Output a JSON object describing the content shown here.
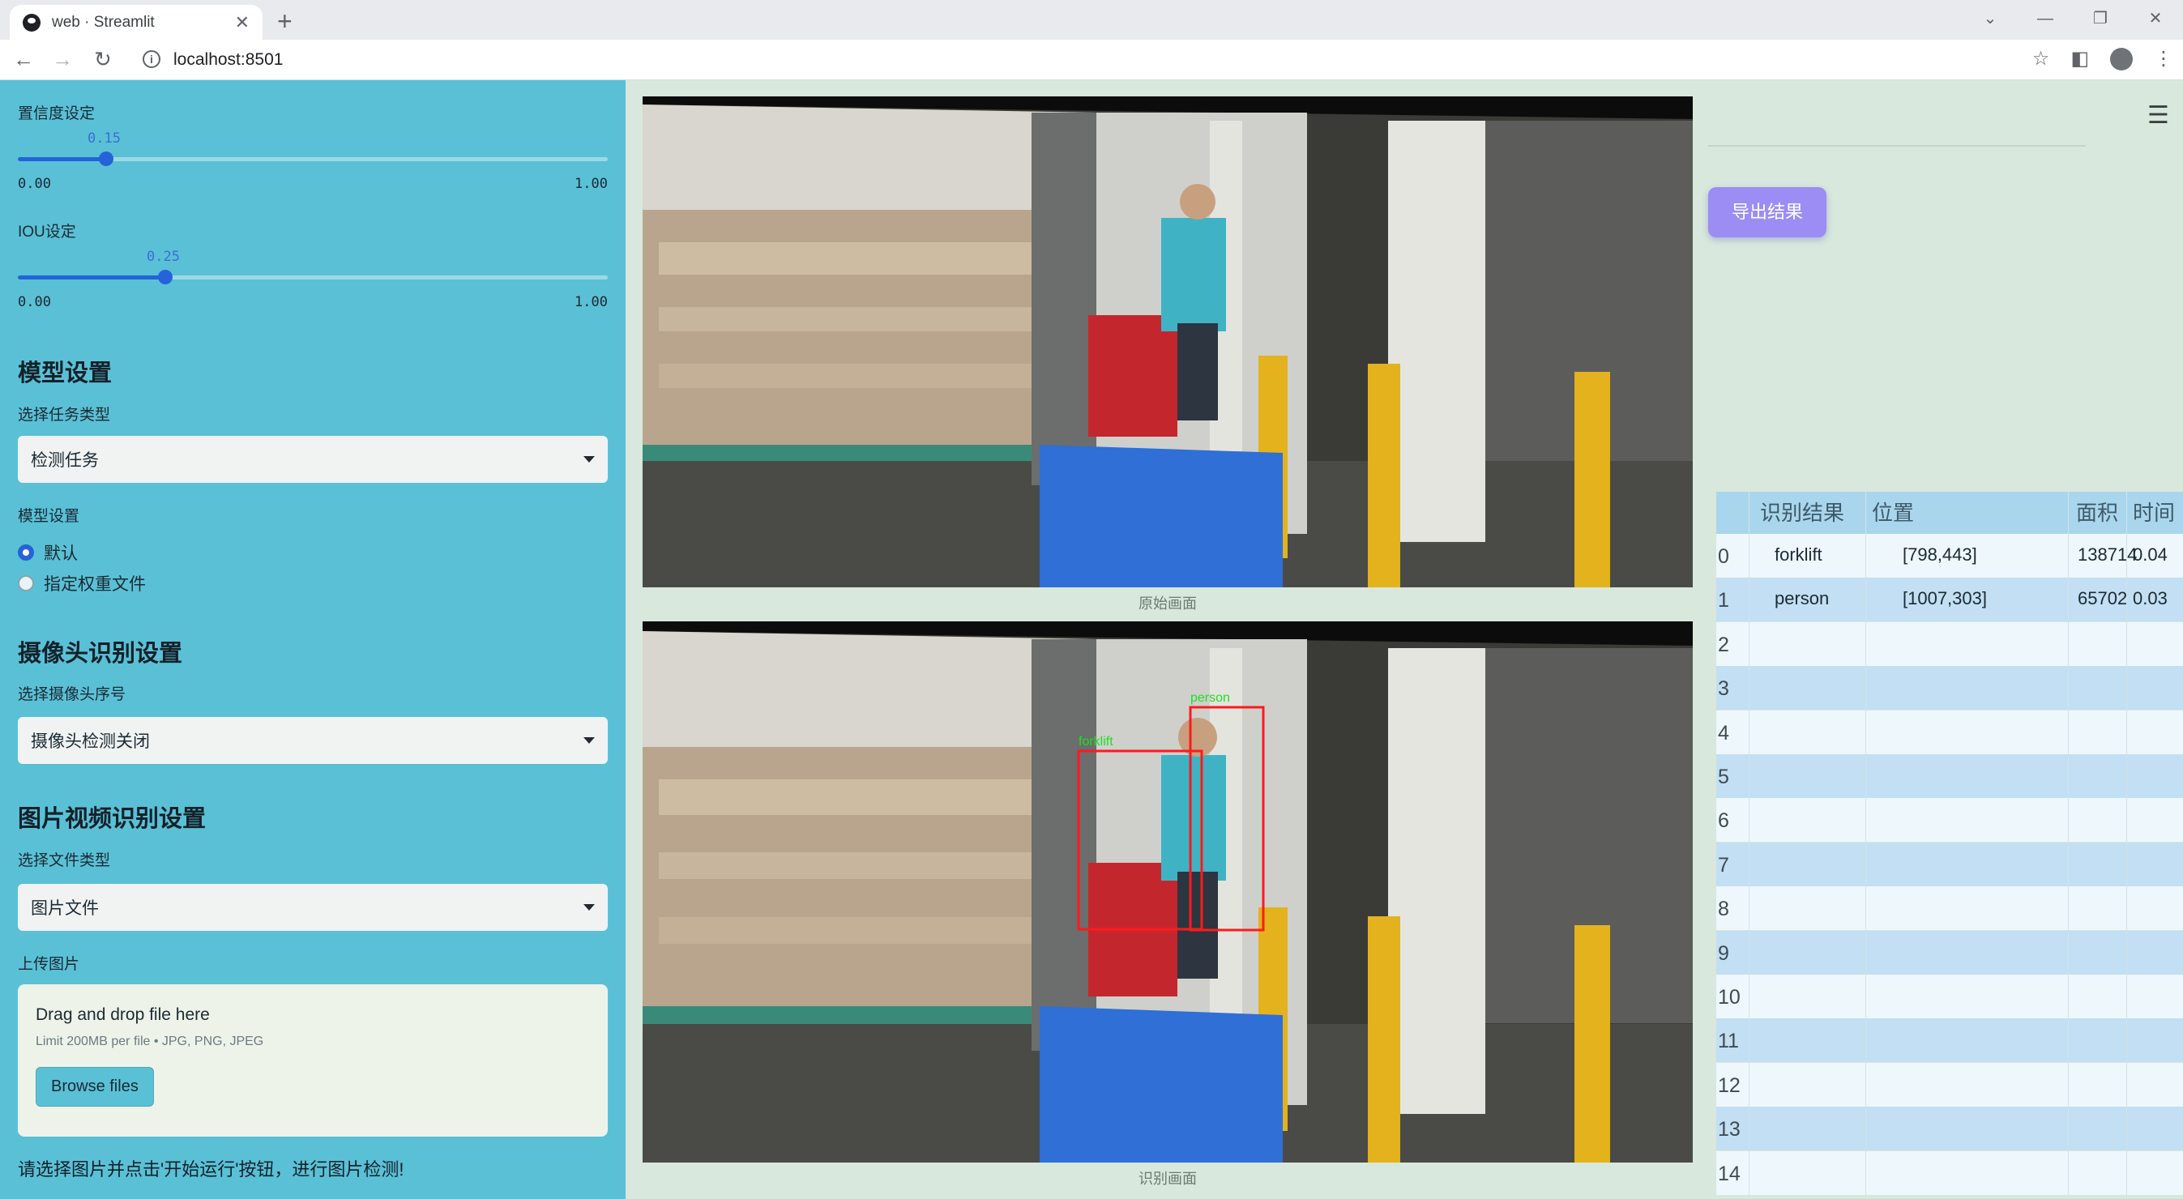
{
  "browser": {
    "tab_title": "web · Streamlit",
    "url": "localhost:8501"
  },
  "sidebar": {
    "confidence_label": "置信度设定",
    "confidence_value": "0.15",
    "confidence_min": "0.00",
    "confidence_max": "1.00",
    "confidence_fraction": 0.15,
    "iou_label": "IOU设定",
    "iou_value": "0.25",
    "iou_min": "0.00",
    "iou_max": "1.00",
    "iou_fraction": 0.25,
    "model_heading": "模型设置",
    "task_type_label": "选择任务类型",
    "task_type_value": "检测任务",
    "model_setting_label": "模型设置",
    "radio_default": "默认",
    "radio_custom": "指定权重文件",
    "camera_heading": "摄像头识别设置",
    "camera_select_label": "选择摄像头序号",
    "camera_select_value": "摄像头检测关闭",
    "media_heading": "图片视频识别设置",
    "file_type_label": "选择文件类型",
    "file_type_value": "图片文件",
    "upload_label": "上传图片",
    "upload_title": "Drag and drop file here",
    "upload_limit": "Limit 200MB per file • JPG, PNG, JPEG",
    "browse_button": "Browse files",
    "footer_hint": "请选择图片并点击'开始运行'按钮，进行图片检测!"
  },
  "main": {
    "original_caption": "原始画面",
    "result_caption": "识别画面",
    "box_label_person": "person",
    "box_label_forklift": "forklift"
  },
  "right": {
    "export_button": "导出结果",
    "table": {
      "headers": [
        "识别结果",
        "位置",
        "面积",
        "时间"
      ],
      "rows": [
        {
          "index": "0",
          "result": "forklift",
          "position": "[798,443]",
          "area": "138714",
          "time": "0.04"
        },
        {
          "index": "1",
          "result": "person",
          "position": "[1007,303]",
          "area": "65702",
          "time": "0.03"
        },
        {
          "index": "2"
        },
        {
          "index": "3"
        },
        {
          "index": "4"
        },
        {
          "index": "5"
        },
        {
          "index": "6"
        },
        {
          "index": "7"
        },
        {
          "index": "8"
        },
        {
          "index": "9"
        },
        {
          "index": "10"
        },
        {
          "index": "11"
        },
        {
          "index": "12"
        },
        {
          "index": "13"
        },
        {
          "index": "14"
        }
      ]
    }
  },
  "icons": {
    "back": "arrow-left-icon",
    "forward": "arrow-right-icon",
    "reload": "reload-icon",
    "info": "info-icon",
    "star": "star-icon",
    "sidepanel": "side-panel-icon",
    "profile": "profile-icon",
    "menu": "hamburger-menu-icon"
  },
  "colors": {
    "sidebar_bg": "#5ac0d6",
    "main_bg": "#d8e8dc",
    "slider_accent": "#2563d9",
    "export_button": "#9b8df3",
    "detection_box": "#ff1a1a"
  }
}
